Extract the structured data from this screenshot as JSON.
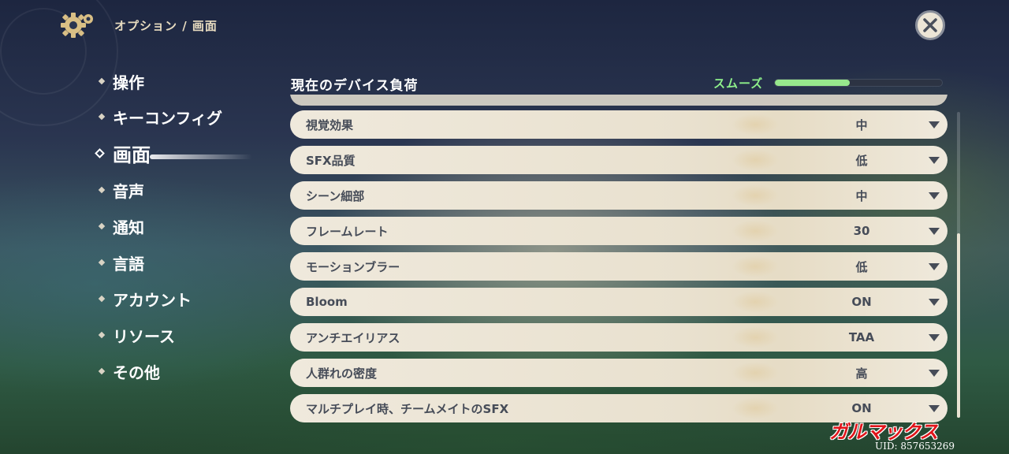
{
  "header": {
    "breadcrumb": "オプション / 画面",
    "close_icon": "close-icon",
    "settings_icon": "gear-icon"
  },
  "nav": {
    "items": [
      {
        "label": "操作"
      },
      {
        "label": "キーコンフィグ"
      },
      {
        "label": "画面",
        "active": true
      },
      {
        "label": "音声"
      },
      {
        "label": "通知"
      },
      {
        "label": "言語"
      },
      {
        "label": "アカウント"
      },
      {
        "label": "リソース"
      },
      {
        "label": "その他"
      }
    ]
  },
  "device_load": {
    "title": "現在のデバイス負荷",
    "status": "スムーズ",
    "status_color": "#8ef08a",
    "level": 0.45
  },
  "settings": [
    {
      "label": "視覚効果",
      "value": "中"
    },
    {
      "label": "SFX品質",
      "value": "低"
    },
    {
      "label": "シーン細部",
      "value": "中"
    },
    {
      "label": "フレームレート",
      "value": "30"
    },
    {
      "label": "モーションブラー",
      "value": "低"
    },
    {
      "label": "Bloom",
      "value": "ON"
    },
    {
      "label": "アンチエイリアス",
      "value": "TAA"
    },
    {
      "label": "人群れの密度",
      "value": "高"
    },
    {
      "label": "マルチプレイ時、チームメイトのSFX",
      "value": "ON"
    }
  ],
  "watermark": {
    "brand": "ガルマックス",
    "uid": "UID: 857653269"
  },
  "colors": {
    "row_bg": "#efe9dc",
    "row_text": "#464c58",
    "accent_gold": "#e8dcc0"
  }
}
